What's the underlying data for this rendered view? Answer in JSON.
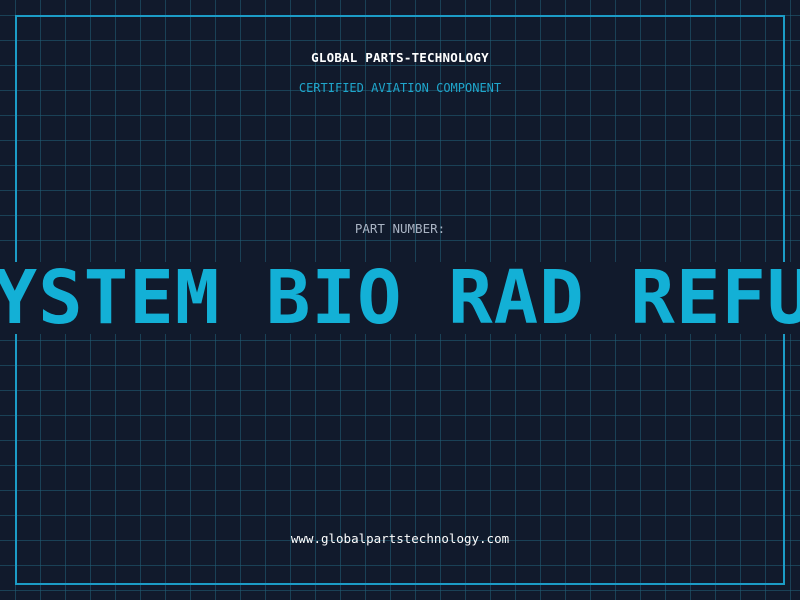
{
  "header": {
    "brand": "GLOBAL PARTS-TECHNOLOGY",
    "subtitle": "CERTIFIED AVIATION COMPONENT"
  },
  "part": {
    "label": "PART NUMBER:",
    "value": "SYSTEM BIO RAD REFU"
  },
  "footer": {
    "website": "www.globalpartstechnology.com"
  },
  "colors": {
    "background": "#111a2c",
    "accent": "#13b0d6",
    "frame": "#1c9cc6",
    "grid": "#206078"
  }
}
